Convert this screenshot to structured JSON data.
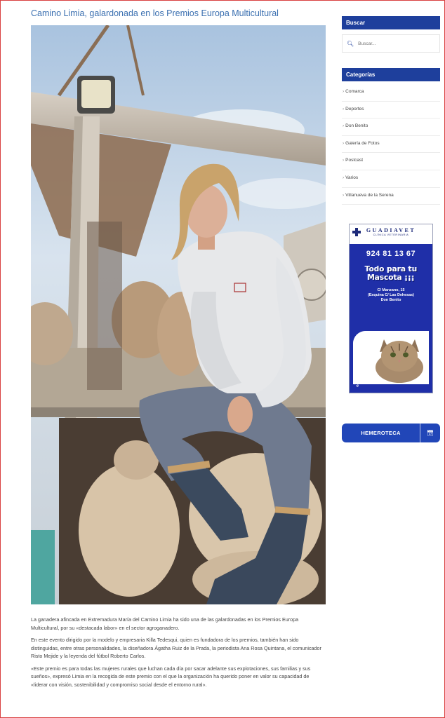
{
  "article": {
    "title": "Camino Limia, galardonada en los Premios Europa Multicultural",
    "image_alt": "Camino Limia con ovejas",
    "paragraphs": [
      "La ganadera afincada en Extremadura María del Camino Limia ha sido una de las galardonadas en los Premios Europa Multicultural, por su «destacada labor» en el sector agroganadero.",
      "En este evento dirigido por la modelo y empresaria Killa Tedesqui, quien es fundadora de los premios, también han sido distinguidas, entre otras personalidades, la diseñadora Ágatha Ruiz de la Prada, la periodista Ana Rosa Quintana, el comunicador Risto Mejide y la leyenda del fútbol Roberto Carlos.",
      "«Este premio es para todas las mujeres rurales que luchan cada día por sacar adelante sus explotaciones, sus familias y sus sueños», expresó Limia en la recogida de este premio con el que la organización ha querido poner en valor su capacidad de «liderar con visión, sostenibilidad y compromiso social desde el entorno rural»."
    ]
  },
  "sidebar": {
    "search_title": "Buscar",
    "search_placeholder": "Buscar...",
    "categories_title": "Categorías",
    "categories": [
      "Comarca",
      "Deportes",
      "Don Benito",
      "Galería de Fotos",
      "Postcast",
      "Varios",
      "Villanueva de la Serena"
    ],
    "hemeroteca_label": "HEMEROTECA"
  },
  "ad": {
    "brand": "GUADIAVET",
    "subtitle": "CLÍNICA VETERINARIA",
    "phone": "924 81 13 67",
    "slogan_line1": "Todo para tu",
    "slogan_line2": "Mascota ¡¡¡",
    "address_line1": "C/ Manzano, 15",
    "address_line2": "(Esquina C/ Las Dehesas)",
    "address_line3": "Don Benito"
  },
  "icons": {
    "search": "search-icon",
    "chevron": "chevron-right-icon",
    "calendar": "calendar-icon",
    "paw": "paw-icon"
  },
  "colors": {
    "link_blue": "#3a6fb0",
    "widget_header": "#1e3f9c",
    "button_blue": "#2146b8",
    "ad_blue": "#1f2fa8"
  }
}
